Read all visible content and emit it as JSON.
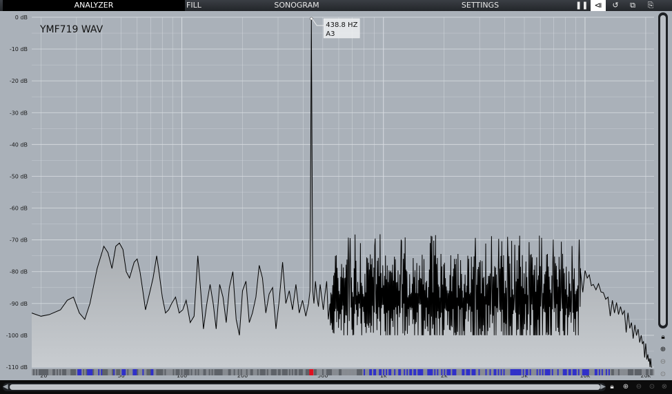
{
  "tabs": {
    "analyzer": "ANALYZER",
    "fill": "FILL",
    "sonogram": "SONOGRAM",
    "settings": "SETTINGS"
  },
  "toolbar_icons": [
    "pause-icon",
    "freeze-icon",
    "reset-icon",
    "copy-icon",
    "paste-icon"
  ],
  "source_label": "YMF719 WAV",
  "peak_tooltip": {
    "freq": "438.8 HZ",
    "note": "A3"
  },
  "colors": {
    "plot_bg": "#aab1b9",
    "grid": "#d8dde2",
    "spectrum_line": "#000000",
    "fill_top": "#6e7378",
    "fill_bottom": "#c8ccd0",
    "strip_blue": "#2a2ad0",
    "strip_red": "#e01020"
  },
  "chart_data": {
    "type": "area",
    "xscale": "log",
    "xlim": [
      18,
      22000
    ],
    "ylim": [
      -110,
      0
    ],
    "grid": true,
    "yticks": [
      "0 dB",
      "-10 dB",
      "-20 dB",
      "-30 dB",
      "-40 dB",
      "-50 dB",
      "-60 dB",
      "-70 dB",
      "-80 dB",
      "-90 dB",
      "-100 dB",
      "-110 dB"
    ],
    "xticks": [
      {
        "label": "20",
        "hz": 20
      },
      {
        "label": "50",
        "hz": 50
      },
      {
        "label": "100",
        "hz": 100
      },
      {
        "label": "200",
        "hz": 200
      },
      {
        "label": "500",
        "hz": 500
      },
      {
        "label": "1k",
        "hz": 1000
      },
      {
        "label": "2k",
        "hz": 2000
      },
      {
        "label": "5k",
        "hz": 5000
      },
      {
        "label": "10k",
        "hz": 10000
      },
      {
        "label": "20k",
        "hz": 20000
      }
    ],
    "peak": {
      "hz": 438.8,
      "db": 0
    },
    "envelope_points": [
      [
        18,
        -93
      ],
      [
        20,
        -94
      ],
      [
        22,
        -93.5
      ],
      [
        25,
        -92
      ],
      [
        27,
        -89
      ],
      [
        29,
        -88
      ],
      [
        31,
        -93
      ],
      [
        33,
        -95
      ],
      [
        35,
        -90
      ],
      [
        38,
        -79
      ],
      [
        41,
        -72
      ],
      [
        43,
        -74
      ],
      [
        45,
        -79
      ],
      [
        47,
        -72
      ],
      [
        49,
        -71
      ],
      [
        51,
        -73
      ],
      [
        53,
        -80
      ],
      [
        55,
        -82
      ],
      [
        58,
        -77
      ],
      [
        60,
        -76
      ],
      [
        62,
        -80
      ],
      [
        64,
        -86
      ],
      [
        66,
        -92
      ],
      [
        69,
        -87
      ],
      [
        72,
        -82
      ],
      [
        75,
        -75
      ],
      [
        77,
        -80
      ],
      [
        80,
        -88
      ],
      [
        83,
        -93
      ],
      [
        86,
        -92
      ],
      [
        89,
        -90
      ],
      [
        93,
        -88
      ],
      [
        97,
        -93
      ],
      [
        101,
        -92
      ],
      [
        105,
        -89
      ],
      [
        110,
        -96
      ],
      [
        115,
        -94
      ],
      [
        120,
        -75
      ],
      [
        124,
        -86
      ],
      [
        128,
        -98
      ],
      [
        133,
        -90
      ],
      [
        138,
        -84
      ],
      [
        143,
        -90
      ],
      [
        148,
        -98
      ],
      [
        154,
        -84
      ],
      [
        160,
        -88
      ],
      [
        166,
        -96
      ],
      [
        172,
        -85
      ],
      [
        179,
        -80
      ],
      [
        186,
        -95
      ],
      [
        193,
        -100
      ],
      [
        200,
        -86
      ],
      [
        208,
        -83
      ],
      [
        216,
        -96
      ],
      [
        224,
        -93
      ],
      [
        233,
        -88
      ],
      [
        242,
        -78
      ],
      [
        251,
        -82
      ],
      [
        261,
        -93
      ],
      [
        271,
        -87
      ],
      [
        282,
        -85
      ],
      [
        293,
        -98
      ],
      [
        304,
        -89
      ],
      [
        316,
        -77
      ],
      [
        328,
        -90
      ],
      [
        341,
        -86
      ],
      [
        354,
        -92
      ],
      [
        368,
        -84
      ],
      [
        382,
        -93
      ],
      [
        397,
        -89
      ],
      [
        412,
        -94
      ],
      [
        425,
        -90
      ],
      [
        432,
        -86
      ],
      [
        436,
        -40
      ],
      [
        438.8,
        0
      ],
      [
        442,
        -40
      ],
      [
        446,
        -86
      ],
      [
        452,
        -90
      ],
      [
        460,
        -83
      ],
      [
        468,
        -88
      ],
      [
        476,
        -91
      ],
      [
        485,
        -84
      ],
      [
        494,
        -88
      ],
      [
        503,
        -92
      ],
      [
        513,
        -87
      ],
      [
        523,
        -83
      ],
      [
        533,
        -95
      ],
      [
        543,
        -90
      ]
    ],
    "noise_region": {
      "from_hz": 543,
      "to_hz": 9500,
      "base_db": -84,
      "jitter_db": 7,
      "lowcut_db": -100
    },
    "rolloff": [
      [
        9500,
        -80
      ],
      [
        11000,
        -84
      ],
      [
        13000,
        -88
      ],
      [
        15000,
        -91
      ],
      [
        17000,
        -96
      ],
      [
        19000,
        -100
      ],
      [
        20500,
        -106
      ],
      [
        21500,
        -110
      ]
    ],
    "bottom_strip_markers": [
      {
        "hz": 438.8,
        "color": "red"
      }
    ]
  }
}
